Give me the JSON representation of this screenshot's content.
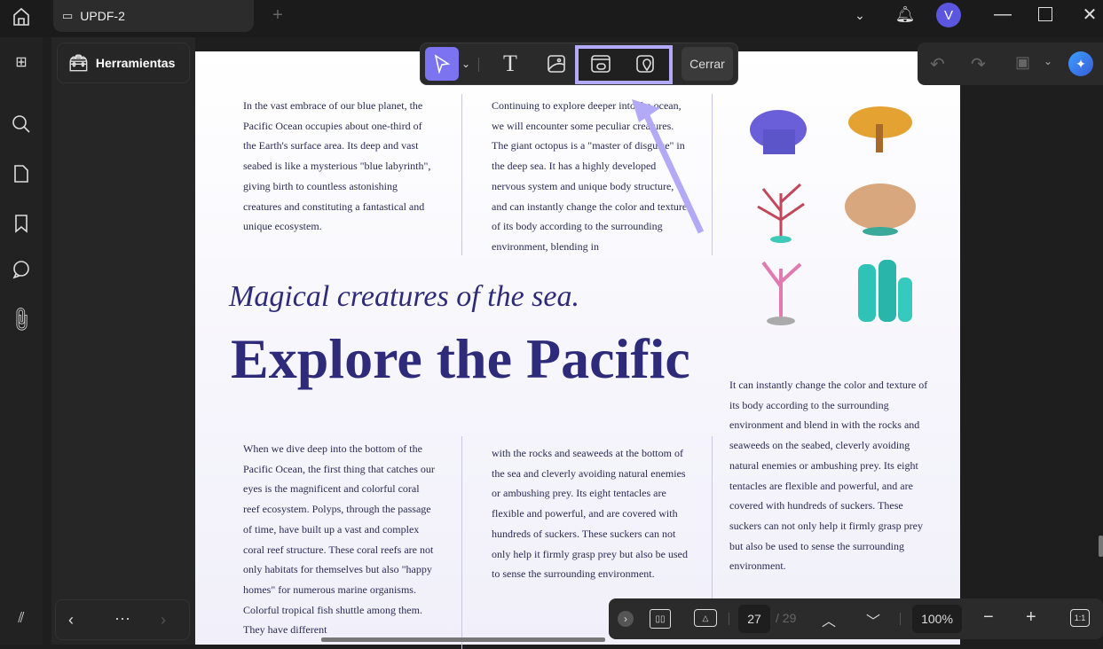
{
  "tab": {
    "title": "UPDF-2"
  },
  "user": {
    "initial": "V"
  },
  "panel": {
    "tools_label": "Herramientas"
  },
  "toolbar": {
    "close_label": "Cerrar"
  },
  "document": {
    "col1_top": "In the vast embrace of our blue planet, the Pacific Ocean occupies about one-third of the Earth's surface area. Its deep and vast seabed is like a mysterious \"blue labyrinth\", giving birth to countless astonishing creatures and constituting a fantastical and unique ecosystem.",
    "col2_top": "Continuing to explore deeper into the ocean, we will encounter some peculiar creatures. The giant octopus is a \"master of disguise\" in the deep sea. It has a highly developed nervous system and unique body structure, and can instantly change the color and texture of its body according to the surrounding environment, blending in",
    "subtitle": "Magical creatures of the sea.",
    "title": "Explore the Pacific",
    "col3_right": "It can instantly change the color and texture of its body according to the surrounding environment and blend in with the rocks and seaweeds on the seabed, cleverly avoiding natural enemies or ambushing prey. Its eight tentacles are flexible and powerful, and are covered with hundreds of suckers. These suckers can not only help it firmly grasp prey but also be used to sense the surrounding environment.",
    "col1_bottom": "When we dive deep into the bottom of the Pacific Ocean, the first thing that catches our eyes is the magnificent and colorful coral reef ecosystem. Polyps, through the passage of time, have built up a vast and complex coral reef structure. These coral reefs are not only habitats for themselves but also \"happy homes\" for numerous marine organisms. Colorful tropical fish shuttle among them. They have different",
    "col2_bottom": "with the rocks and seaweeds at the bottom of the sea and cleverly avoiding natural enemies or ambushing prey. Its eight tentacles are flexible and powerful, and are covered with hundreds of suckers. These suckers can not only help it firmly grasp prey but also be used to sense the surrounding environment."
  },
  "pager": {
    "current": "27",
    "total": "/ 29",
    "zoom": "100%",
    "fit": "1:1"
  },
  "colors": {
    "accent": "#7b73f0",
    "highlight": "#b3aaf7",
    "text": "#2a2a55",
    "heading": "#2e2b7a"
  }
}
